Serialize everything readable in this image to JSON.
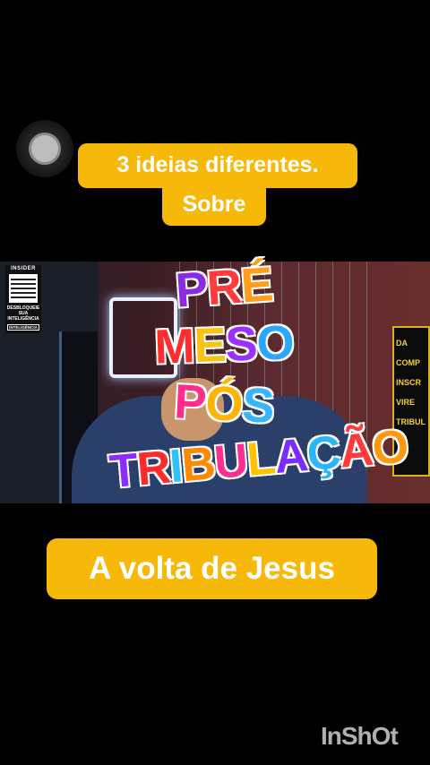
{
  "captions": {
    "top_line1": "3  ideias diferentes.",
    "top_line2": "Sobre",
    "bottom": "A volta de Jesus"
  },
  "video": {
    "insider_brand": "INSIDER",
    "insider_desbloqueie": "DESBLOQUEIE",
    "insider_sub": "SUA INTELIGÊNCIA",
    "insider_intel": "INTELIGÊNCIA",
    "sign_text": "DA\nCOMP\nINSCR\nVIRE\nTRIBUL"
  },
  "overlay_title": {
    "line1": [
      "P",
      "R",
      "É"
    ],
    "line2": [
      "M",
      "E",
      "S",
      "O"
    ],
    "line3": [
      "P",
      "Ó",
      "S"
    ],
    "line4": [
      "T",
      "R",
      "I",
      "B",
      "U",
      "L",
      "A",
      "Ç",
      "Ã",
      "O"
    ]
  },
  "watermark": "InShOt",
  "colors": {
    "caption_bg": "#f6b90a",
    "background": "#000000"
  }
}
